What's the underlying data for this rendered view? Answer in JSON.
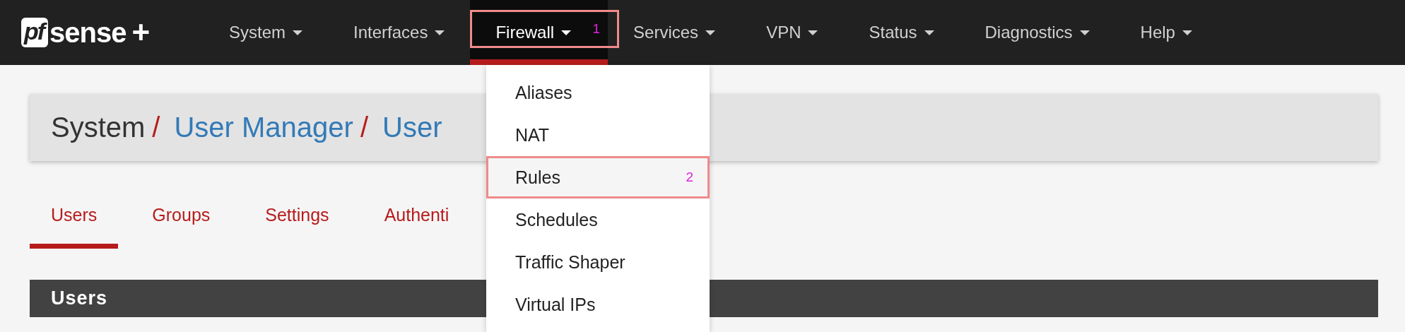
{
  "logo": {
    "mark": "pf",
    "name": "sense",
    "plus": "+"
  },
  "nav": [
    {
      "label": "System",
      "selected": false
    },
    {
      "label": "Interfaces",
      "selected": false
    },
    {
      "label": "Firewall",
      "selected": true,
      "callout": "1"
    },
    {
      "label": "Services",
      "selected": false
    },
    {
      "label": "VPN",
      "selected": false
    },
    {
      "label": "Status",
      "selected": false
    },
    {
      "label": "Diagnostics",
      "selected": false
    },
    {
      "label": "Help",
      "selected": false
    }
  ],
  "dropdown": [
    {
      "label": "Aliases",
      "selected": false
    },
    {
      "label": "NAT",
      "selected": false
    },
    {
      "label": "Rules",
      "selected": true,
      "callout": "2"
    },
    {
      "label": "Schedules",
      "selected": false
    },
    {
      "label": "Traffic Shaper",
      "selected": false
    },
    {
      "label": "Virtual IPs",
      "selected": false
    }
  ],
  "breadcrumb": {
    "separator": "/",
    "items": [
      {
        "label": "System",
        "link": false
      },
      {
        "label": "User Manager",
        "link": true
      },
      {
        "label": "User",
        "link": true
      }
    ]
  },
  "tabs": [
    {
      "label": "Users",
      "selected": true
    },
    {
      "label": "Groups",
      "selected": false
    },
    {
      "label": "Settings",
      "selected": false
    },
    {
      "label": "Authenti",
      "selected": false
    }
  ],
  "panel": {
    "title": "Users"
  }
}
